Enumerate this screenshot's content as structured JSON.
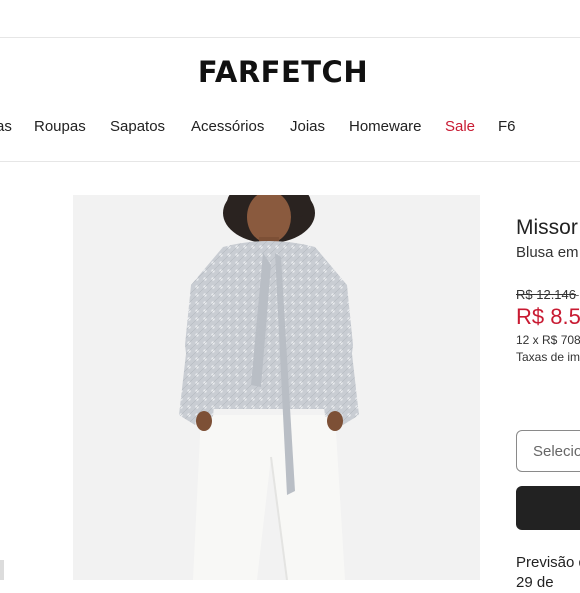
{
  "header": {
    "logo_text": "FARFETCH"
  },
  "nav": {
    "items": [
      {
        "label": "as"
      },
      {
        "label": "Roupas"
      },
      {
        "label": "Sapatos"
      },
      {
        "label": "Acessórios"
      },
      {
        "label": "Joias"
      },
      {
        "label": "Homeware"
      },
      {
        "label": "Sale"
      },
      {
        "label": "F6"
      }
    ]
  },
  "product": {
    "brand": "Missor",
    "description": "Blusa em",
    "old_price": "R$ 12.146",
    "old_price_suffix": "-",
    "price": "R$ 8.5",
    "installments": "12 x R$ 708",
    "taxes_note": "Taxas de im",
    "size_placeholder": "Selecio",
    "delivery_label": "Previsão d",
    "delivery_line2": "29 de"
  },
  "colors": {
    "sale": "#c81a32",
    "button": "#222222",
    "image_background": "#f2f2f2"
  }
}
